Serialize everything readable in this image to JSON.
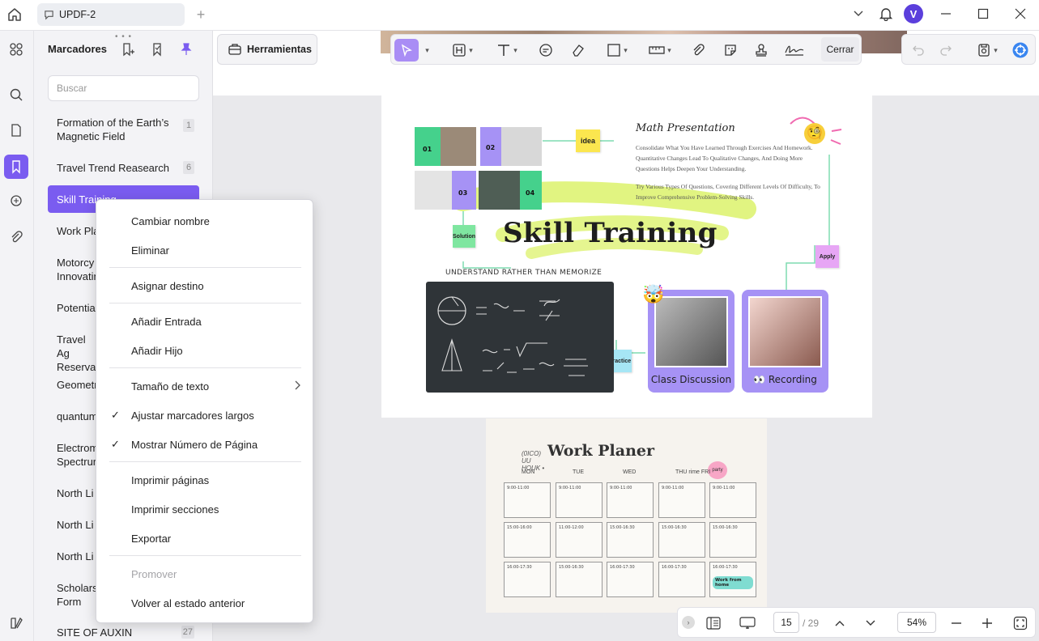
{
  "window": {
    "tab_title": "UPDF-2",
    "avatar_letter": "V"
  },
  "panel": {
    "title": "Marcadores",
    "search_placeholder": "Buscar",
    "bookmarks": [
      {
        "label": "Formation of the Earth’s Magnetic Field",
        "page": "1"
      },
      {
        "label": "Travel Trend Reasearch",
        "page": "6"
      },
      {
        "label": "Skill Training",
        "page": "15"
      },
      {
        "label": "Work Pla",
        "page": ""
      },
      {
        "label": "Motorcy Innovatin",
        "page": ""
      },
      {
        "label": "Potentia",
        "page": ""
      },
      {
        "label": "Travel Ag Reservat",
        "page": ""
      },
      {
        "label": "Geometr",
        "page": ""
      },
      {
        "label": "quantum",
        "page": ""
      },
      {
        "label": "Electrom Spectrur",
        "page": ""
      },
      {
        "label": "North Li",
        "page": ""
      },
      {
        "label": "North Li",
        "page": ""
      },
      {
        "label": "North Li",
        "page": ""
      },
      {
        "label": "Scholars Form",
        "page": ""
      },
      {
        "label": "SITE OF AUXIN",
        "page": "27"
      }
    ]
  },
  "toolbar": {
    "tools_label": "Herramientas",
    "close_label": "Cerrar"
  },
  "context_menu": {
    "rename": "Cambiar nombre",
    "delete": "Eliminar",
    "assign_destination": "Asignar destino",
    "add_entry": "Añadir Entrada",
    "add_child": "Añadir Hijo",
    "text_size": "Tamaño de texto",
    "wrap_long": "Ajustar marcadores largos",
    "show_page_number": "Mostrar Número de Página",
    "print_pages": "Imprimir páginas",
    "print_sections": "Imprimir secciones",
    "export": "Exportar",
    "promote": "Promover",
    "revert": "Volver al estado anterior"
  },
  "navigation": {
    "current_page": "15",
    "total_pages": "/ 29",
    "zoom": "54%"
  },
  "document": {
    "page1": {
      "tiles": [
        "01",
        "02",
        "03",
        "04"
      ],
      "idea": "idea",
      "solution": "Solution",
      "apply": "Apply",
      "practice": "Practice",
      "math_title": "Math Presentation",
      "math_p1": "Consolidate What You Have Learned Through Exercises And Homework. Quantitative Changes Lead To Qualitative Changes, And Doing More Questions Helps Deepen Your Understanding.",
      "math_p2": "Try Various Types Of Questions, Covering Different Levels Of Difficulty, To Improve Comprehensive Problem-Solving Skills.",
      "headline": "Skill Training",
      "understand": "UNDERSTAND RATHER THAN MEMORIZE",
      "card1": "Class Discussion",
      "card2": "👀 Recording"
    },
    "page2": {
      "title": "Work Planer",
      "subtitle": "(0ICO) UU HOUK •",
      "days": [
        "MON",
        "TUE",
        "WED",
        "THU rime FRI"
      ],
      "sticker": "party",
      "cells": [
        [
          "9:00-11:00",
          "9:00-11:00",
          "9:00-11:00",
          "9:00-11:00",
          "9:00-11:00"
        ],
        [
          "15:00-16:00",
          "11:00-12:00",
          "15:00-16:30",
          "15:00-16:30",
          "15:00-16:30"
        ],
        [
          "16:00-17:30",
          "15:00-16:30",
          "16:00-17:30",
          "16:00-17:30",
          "16:00-17:30"
        ]
      ],
      "work_from_home": "Work from home"
    }
  }
}
